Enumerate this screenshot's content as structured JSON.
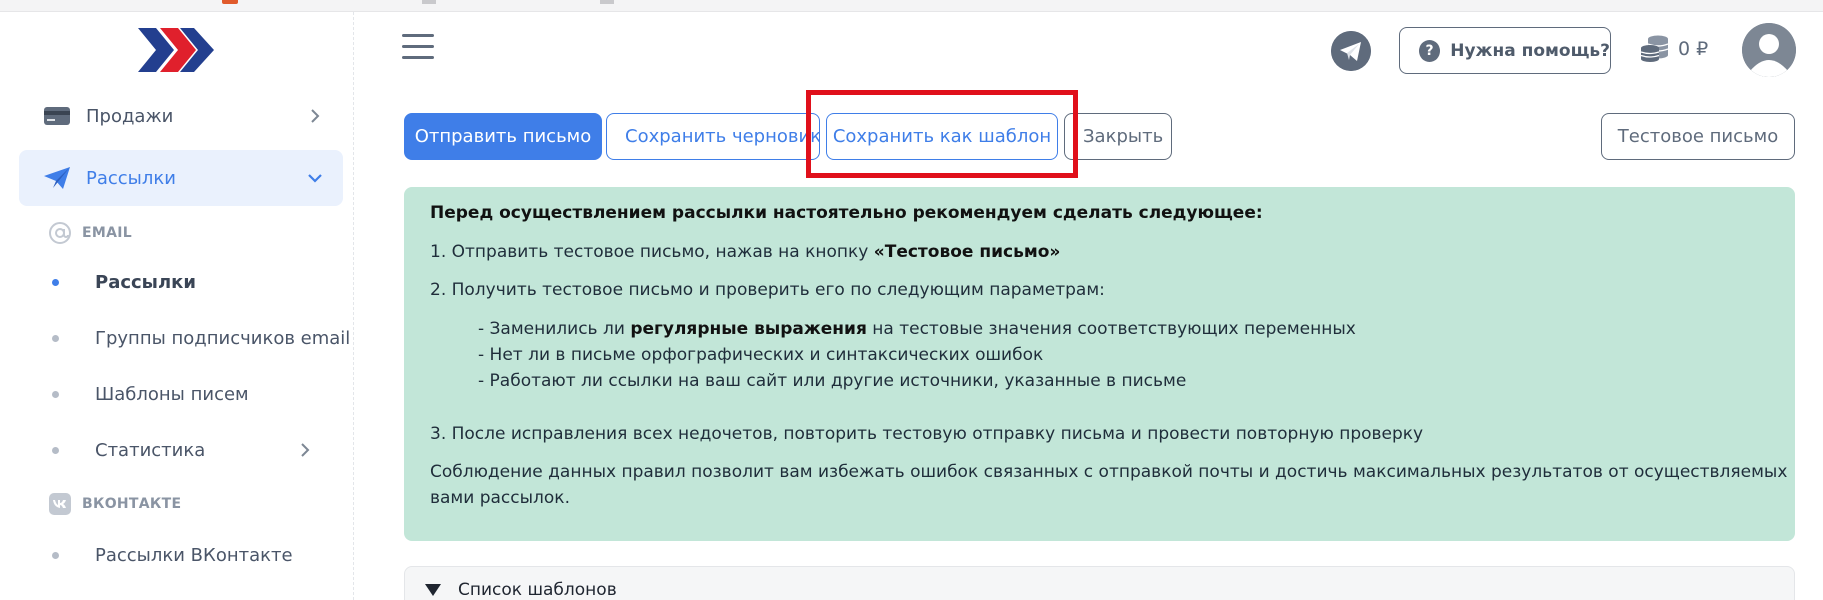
{
  "colors": {
    "accent": "#3f7ee8",
    "sidebar_active_bg": "#eaf1fd",
    "info_bg": "#c2e6d8",
    "highlight": "#e0101b",
    "logo_blue": "#233f8f",
    "logo_red": "#e0202c"
  },
  "sidebar": {
    "items": [
      {
        "label": "Продажи",
        "icon": "credit-card-icon"
      },
      {
        "label": "Рассылки",
        "icon": "paper-plane-icon",
        "active": true
      }
    ],
    "sections": [
      {
        "label": "EMAIL",
        "icon": "at-sign-icon"
      },
      {
        "label": "ВКОНТАКТЕ",
        "icon": "vk-icon"
      }
    ],
    "email_items": [
      {
        "label": "Рассылки",
        "active": true
      },
      {
        "label": "Группы подписчиков email"
      },
      {
        "label": "Шаблоны писем"
      },
      {
        "label": "Статистика"
      }
    ],
    "vk_items": [
      {
        "label": "Рассылки ВКонтакте"
      }
    ]
  },
  "header": {
    "help_label": "Нужна помощь?",
    "balance": "0 ₽"
  },
  "toolbar": {
    "send": "Отправить письмо",
    "save_draft": "Сохранить черновик",
    "save_template": "Сохранить как шаблон",
    "close": "Закрыть",
    "test_letter": "Тестовое письмо"
  },
  "info": {
    "heading": "Перед осуществлением рассылки настоятельно рекомендуем сделать следующее:",
    "step1_prefix": "1. Отправить тестовое письмо, нажав на кнопку ",
    "step1_bold": "«Тестовое письмо»",
    "step2": "2. Получить тестовое письмо и проверить его по следующим параметрам:",
    "check1_prefix": "- Заменились ли ",
    "check1_bold": "регулярные выражения",
    "check1_suffix": " на тестовые значения соответствующих переменных",
    "check2": "- Нет ли в письме орфографических и синтаксических ошибок",
    "check3": "- Работают ли ссылки на ваш сайт или другие источники, указанные в письме",
    "step3": "3. После исправления всех недочетов, повторить тестовую отправку письма и провести повторную проверку",
    "footer_line1": "Соблюдение данных правил позволит вам избежать ошибок связанных с отправкой почты и достичь максимальных результатов от осуществляемых",
    "footer_line2": "вами рассылок."
  },
  "templates": {
    "label": "Список шаблонов"
  }
}
